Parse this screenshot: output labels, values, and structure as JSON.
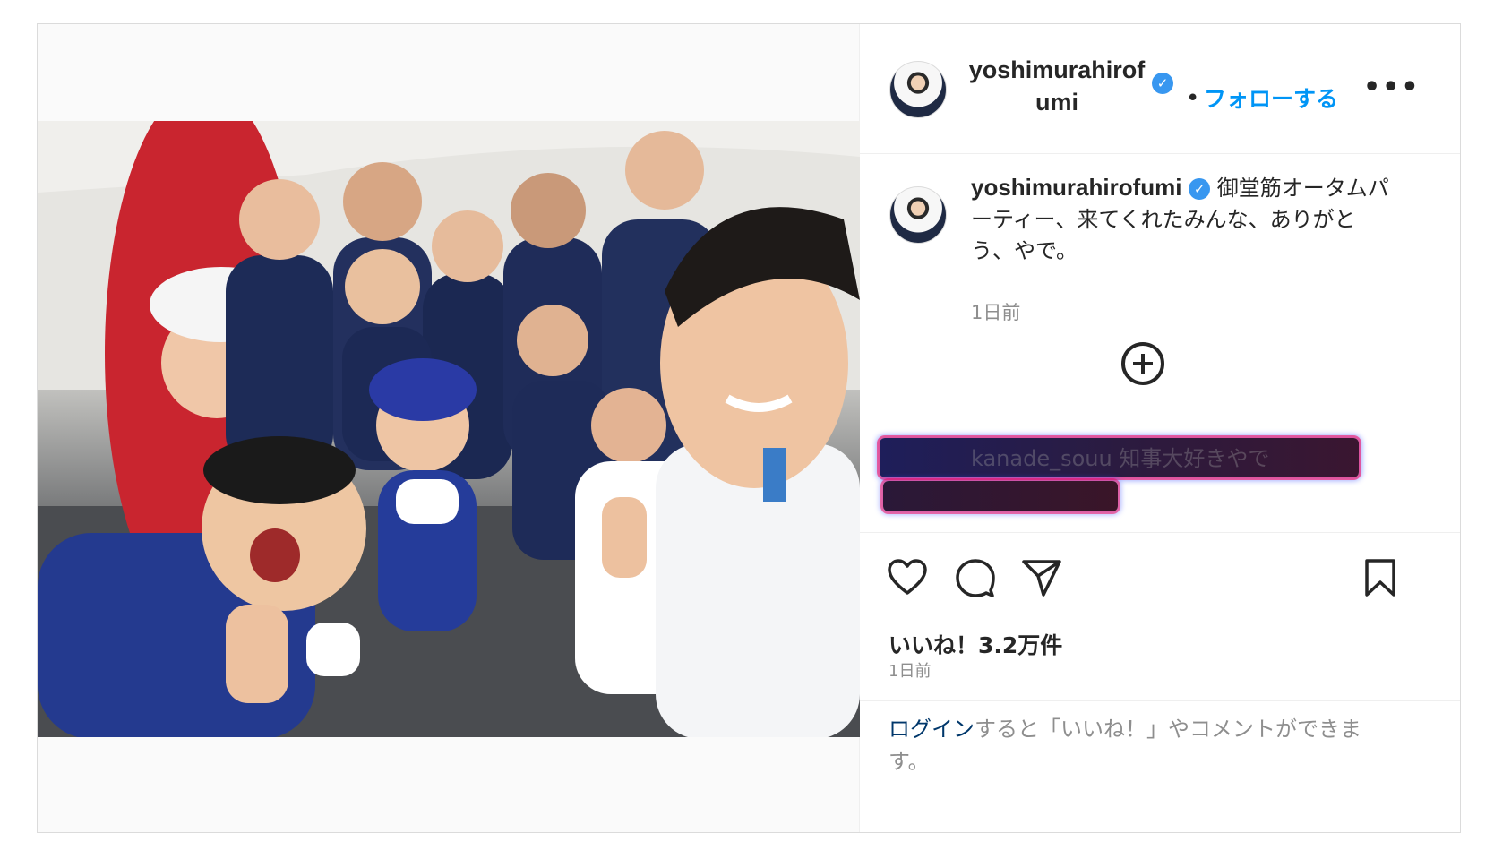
{
  "header": {
    "username_line1": "yoshimurahirof",
    "username_line2": "umi",
    "separator": "•",
    "follow_label": "フォローする",
    "more_label": "•••"
  },
  "caption": {
    "username": "yoshimurahirofumi",
    "text": "御堂筋オータムパーティー、来てくれたみんな、ありがとう、やで。",
    "time": "1日前"
  },
  "comment_redacted": {
    "username": "kanade_souu",
    "text": "知事大好きやで"
  },
  "icons": {
    "verified": "verified-badge-icon",
    "plus": "plus-circle-icon",
    "like": "heart-icon",
    "comment": "comment-icon",
    "share": "send-icon",
    "save": "bookmark-icon"
  },
  "stats": {
    "likes": "いいね！3.2万件",
    "time": "1日前"
  },
  "login_prompt": {
    "link": "ログイン",
    "rest": "すると「いいね！」やコメントができます。"
  },
  "colors": {
    "accent": "#0095f6",
    "verified": "#3897f0",
    "link": "#00376b",
    "muted": "#8e8e8e"
  }
}
